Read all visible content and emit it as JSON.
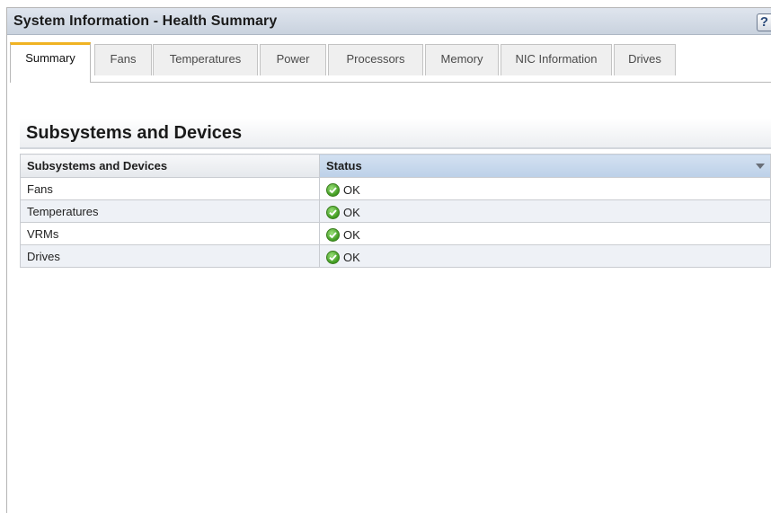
{
  "window": {
    "title": "System Information - Health Summary",
    "help_label": "?"
  },
  "tabs": [
    {
      "label": "Summary",
      "active": true
    },
    {
      "label": "Fans",
      "active": false
    },
    {
      "label": "Temperatures",
      "active": false
    },
    {
      "label": "Power",
      "active": false
    },
    {
      "label": "Processors",
      "active": false
    },
    {
      "label": "Memory",
      "active": false
    },
    {
      "label": "NIC Information",
      "active": false
    },
    {
      "label": "Drives",
      "active": false
    }
  ],
  "section": {
    "title": "Subsystems and Devices"
  },
  "table": {
    "columns": [
      "Subsystems and Devices",
      "Status"
    ],
    "rows": [
      {
        "name": "Fans",
        "status": "OK",
        "status_icon": "ok-check-icon"
      },
      {
        "name": "Temperatures",
        "status": "OK",
        "status_icon": "ok-check-icon"
      },
      {
        "name": "VRMs",
        "status": "OK",
        "status_icon": "ok-check-icon"
      },
      {
        "name": "Drives",
        "status": "OK",
        "status_icon": "ok-check-icon"
      }
    ]
  },
  "colors": {
    "active_tab_accent": "#f0b323",
    "status_ok": "#3f9a1f",
    "sorted_column": "#bcd0e8"
  }
}
